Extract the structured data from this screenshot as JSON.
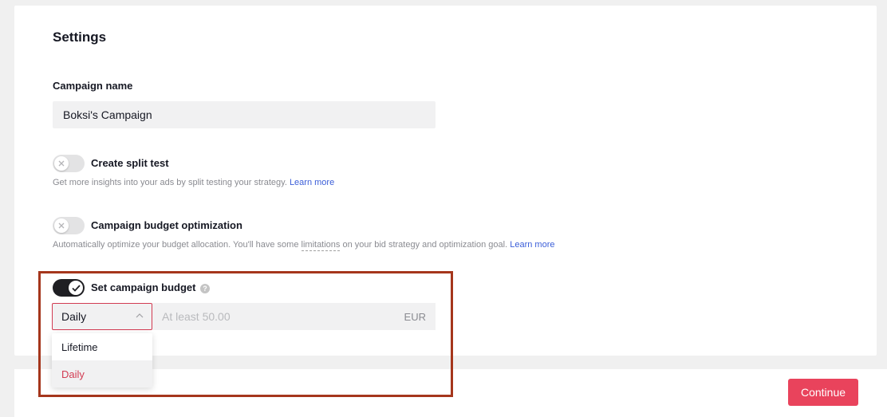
{
  "settings": {
    "title": "Settings",
    "campaign_name": {
      "label": "Campaign name",
      "value": "Boksi's Campaign"
    },
    "split_test": {
      "label": "Create split test",
      "enabled": false,
      "description": "Get more insights into your ads by split testing your strategy.",
      "link": "Learn more"
    },
    "cbo": {
      "label": "Campaign budget optimization",
      "enabled": false,
      "description_before": "Automatically optimize your budget allocation. You'll have some",
      "description_term": "limitations",
      "description_after": "on your bid strategy and optimization goal.",
      "link": "Learn more"
    },
    "budget": {
      "label": "Set campaign budget",
      "enabled": true,
      "help_icon": "?",
      "type_selected": "Daily",
      "amount_placeholder": "At least 50.00",
      "currency": "EUR",
      "options": [
        "Lifetime",
        "Daily"
      ]
    }
  },
  "footer": {
    "continue_label": "Continue"
  },
  "colors": {
    "accent": "#e9435c",
    "highlight_border": "#a5361c",
    "link": "#3b5ed8"
  }
}
